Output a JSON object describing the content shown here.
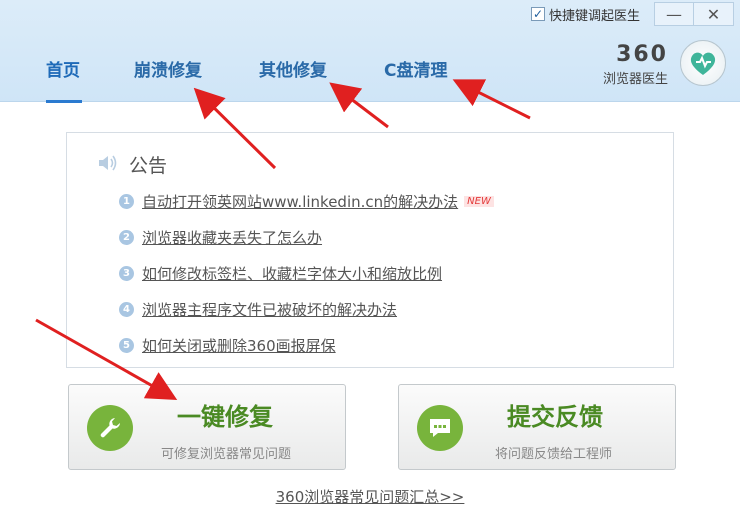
{
  "title_bar": {
    "hotkey_label": "快捷键调起医生",
    "hotkey_checked": true,
    "minimize_glyph": "—",
    "close_glyph": "✕"
  },
  "nav": {
    "tabs": [
      {
        "label": "首页",
        "active": true
      },
      {
        "label": "崩溃修复",
        "active": false
      },
      {
        "label": "其他修复",
        "active": false
      },
      {
        "label": "C盘清理",
        "active": false
      }
    ]
  },
  "logo": {
    "brand": "360",
    "product": "浏览器医生",
    "icon": "heart-check-icon"
  },
  "announcement": {
    "title": "公告",
    "icon": "speaker-icon",
    "items": [
      {
        "num": "1",
        "text": "自动打开领英网站www.linkedin.cn的解决办法",
        "badge": "NEW"
      },
      {
        "num": "2",
        "text": "浏览器收藏夹丢失了怎么办"
      },
      {
        "num": "3",
        "text": "如何修改标签栏、收藏栏字体大小和缩放比例"
      },
      {
        "num": "4",
        "text": "浏览器主程序文件已被破坏的解决办法"
      },
      {
        "num": "5",
        "text": "如何关闭或删除360画报屏保"
      }
    ]
  },
  "actions": {
    "repair": {
      "title": "一键修复",
      "subtitle": "可修复浏览器常见问题",
      "icon": "wrench-icon"
    },
    "feedback": {
      "title": "提交反馈",
      "subtitle": "将问题反馈给工程师",
      "icon": "chat-icon"
    }
  },
  "footer": {
    "faq_link": "360浏览器常见问题汇总>>"
  },
  "colors": {
    "header_bg": "#d6e9f8",
    "nav_text": "#2a6aa8",
    "action_green": "#4a8a23",
    "arrow_red": "#e02020"
  }
}
